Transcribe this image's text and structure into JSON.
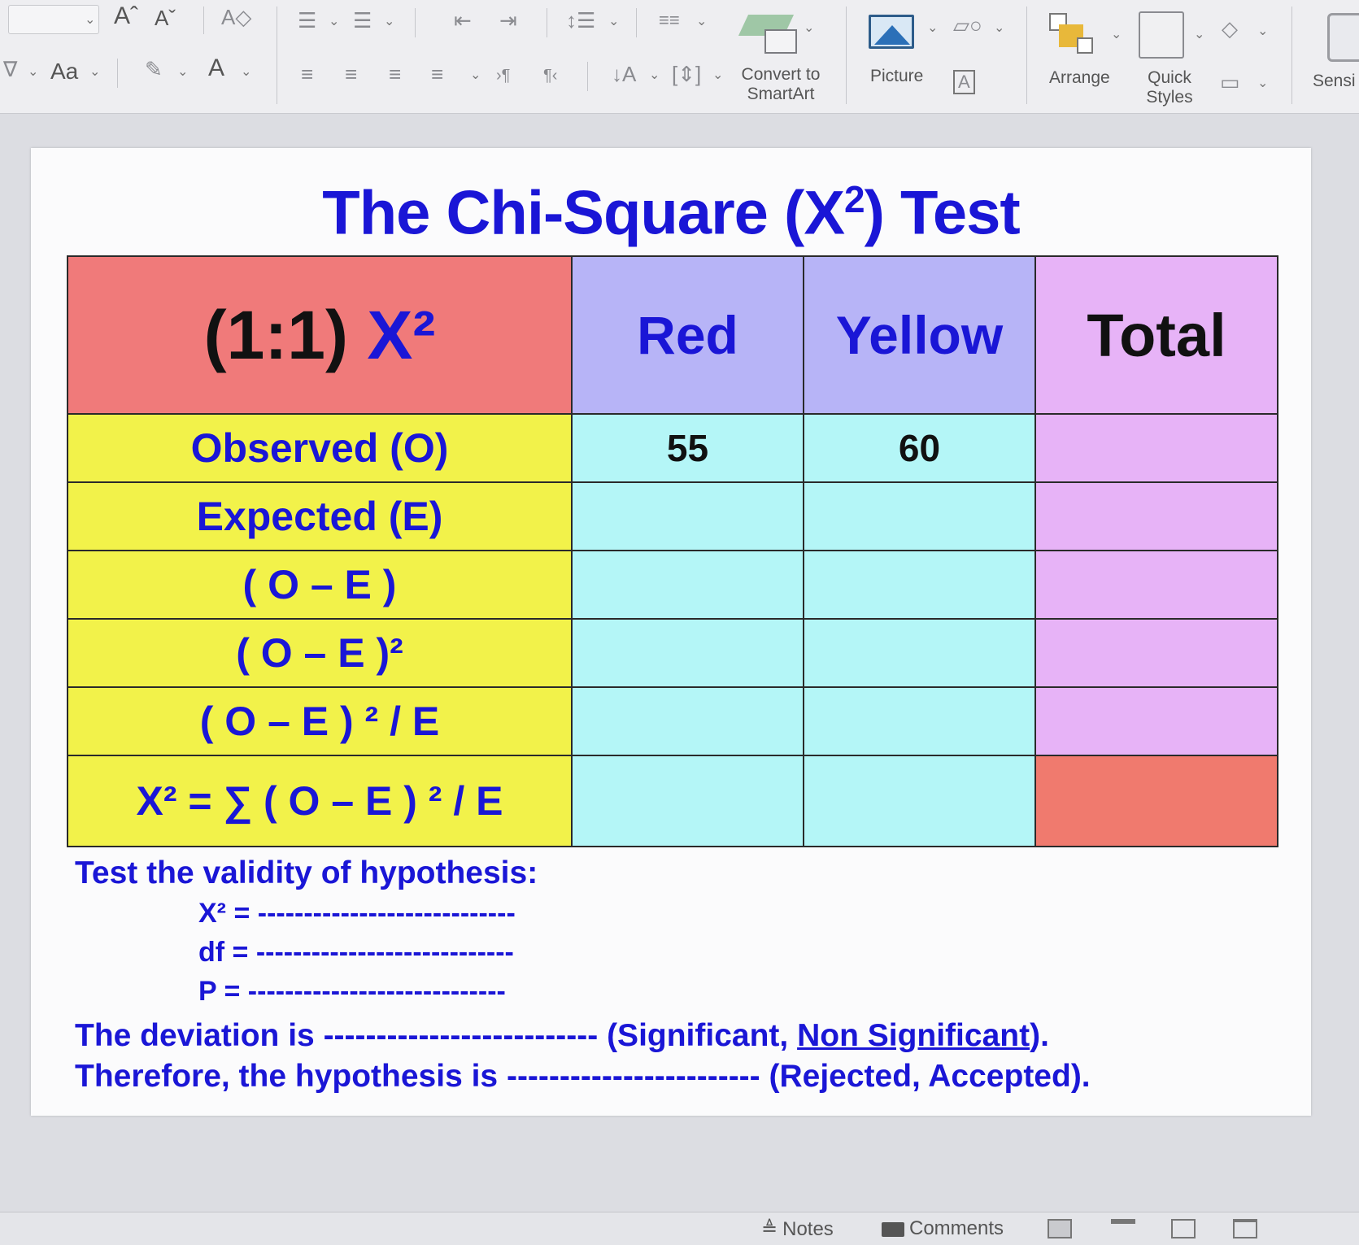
{
  "ribbon": {
    "font_size_up": "Aˆ",
    "font_size_down": "Aˇ",
    "change_case": "Aa",
    "font_color": "A",
    "convert_smartart": "Convert to\nSmartArt",
    "picture": "Picture",
    "arrange": "Arrange",
    "quick_styles": "Quick\nStyles",
    "sensitivity": "Sensi"
  },
  "slide": {
    "title_main": "The Chi-Square (X",
    "title_sup": "2",
    "title_end": ") Test",
    "table": {
      "corner_prefix": "(1:1) ",
      "corner_x2": "X²",
      "col_red": "Red",
      "col_yellow": "Yellow",
      "col_total": "Total",
      "rows": [
        {
          "label": "Observed (O)",
          "red": "55",
          "yellow": "60",
          "total": ""
        },
        {
          "label": "Expected (E)",
          "red": "",
          "yellow": "",
          "total": ""
        },
        {
          "label": "( O – E )",
          "red": "",
          "yellow": "",
          "total": ""
        },
        {
          "label": "( O – E )²",
          "red": "",
          "yellow": "",
          "total": ""
        },
        {
          "label": "( O – E ) ² / E",
          "red": "",
          "yellow": "",
          "total": ""
        },
        {
          "label": "X² = ∑ ( O – E ) ² / E",
          "red": "",
          "yellow": "",
          "total": ""
        }
      ]
    },
    "hypothesis": {
      "heading": "Test the validity of hypothesis:",
      "x2_line": "X² = ----------------------------",
      "df_line": "df = ----------------------------",
      "p_line": "P = ----------------------------",
      "deviation_prefix": "The deviation is -------------------------- (Significant, ",
      "deviation_link": "Non Significant",
      "deviation_suffix": ").",
      "hypothesis_line": "Therefore, the hypothesis is ------------------------ (Rejected, Accepted)."
    }
  },
  "statusbar": {
    "notes": "Notes",
    "comments": "Comments"
  },
  "colors": {
    "title_blue": "#1a16d6",
    "corner_red": "#f07a7a",
    "header_purple": "#b7b4f7",
    "total_pink": "#e7b3f7",
    "label_yellow": "#f2f24a",
    "value_cyan": "#b4f6f7",
    "final_cell_red": "#f07a6e"
  }
}
